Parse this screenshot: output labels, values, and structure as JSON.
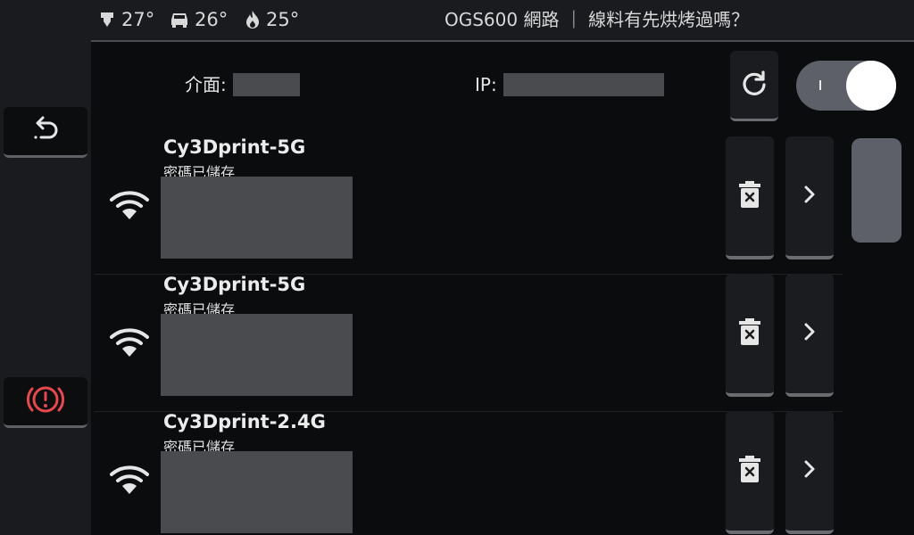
{
  "topbar": {
    "temps": [
      {
        "icon": "extruder-icon",
        "value": "27°"
      },
      {
        "icon": "heated-bed-icon",
        "value": "26°"
      },
      {
        "icon": "chamber-heat-icon",
        "value": "25°"
      }
    ],
    "title": "OGS600 網路 ｜ 線料有先烘烤過嗎？"
  },
  "sidebar": {
    "back_icon": "back-arrow-icon",
    "estop_icon": "emergency-stop-icon"
  },
  "info": {
    "interface_label": "介面:",
    "ip_label": "IP:"
  },
  "wifi_toggle": {
    "state": "on"
  },
  "networks": [
    {
      "ssid": "Cy3Dprint-5G",
      "status": "密碼已儲存"
    },
    {
      "ssid": "Cy3Dprint-5G",
      "status": "密碼已儲存"
    },
    {
      "ssid": "Cy3Dprint-2.4G",
      "status": "密碼已儲存"
    }
  ],
  "colors": {
    "background": "#0b0c0e",
    "panel": "#1a1b1e",
    "accent_red": "#e5484d",
    "redacted": "#4a4b4f"
  }
}
